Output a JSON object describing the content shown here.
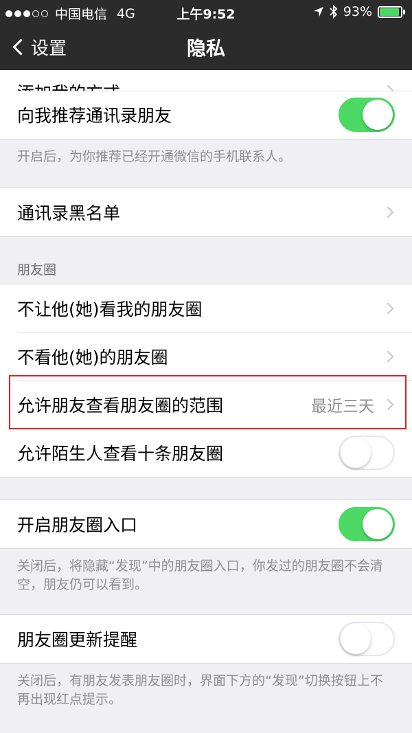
{
  "status_bar": {
    "carrier": "中国电信",
    "network": "4G",
    "time": "上午9:52",
    "battery_percent": "93%",
    "battery_level": 0.93,
    "location_icon": "location-arrow-icon",
    "bluetooth_icon": "bluetooth-icon"
  },
  "nav": {
    "back_label": "设置",
    "title": "隐私"
  },
  "partial_row": {
    "label": "添加我的方式"
  },
  "rows": {
    "recommend_contacts": {
      "label": "向我推荐通讯录朋友",
      "on": true
    },
    "recommend_footer": "开启后，为你推荐已经开通微信的手机联系人。",
    "contacts_blacklist": {
      "label": "通讯录黑名单"
    },
    "moments_header": "朋友圈",
    "hide_my_moments": {
      "label": "不让他(她)看我的朋友圈"
    },
    "hide_their_moments": {
      "label": "不看他(她)的朋友圈"
    },
    "moments_range": {
      "label": "允许朋友查看朋友圈的范围",
      "value": "最近三天"
    },
    "stranger_ten": {
      "label": "允许陌生人查看十条朋友圈",
      "on": false
    },
    "moments_entry": {
      "label": "开启朋友圈入口",
      "on": true
    },
    "moments_entry_footer": "关闭后，将隐藏“发现”中的朋友圈入口，你发过的朋友圈不会清空，朋友仍可以看到。",
    "moments_update": {
      "label": "朋友圈更新提醒",
      "on": false
    },
    "moments_update_footer": "关闭后，有朋友发表朋友圈时，界面下方的“发现”切换按钮上不再出现红点提示。"
  },
  "colors": {
    "toggle_on": "#4cd964",
    "highlight": "#e02020",
    "nav_background": "#2b2b2b"
  }
}
